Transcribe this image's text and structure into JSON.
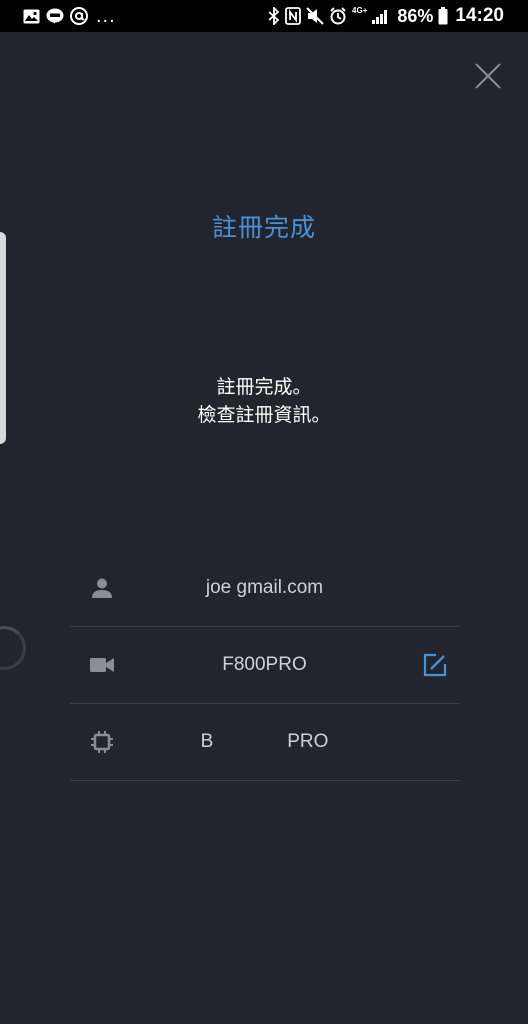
{
  "status_bar": {
    "overflow": "...",
    "network": "4G+",
    "battery": "86%",
    "time": "14:20",
    "icons_left": [
      "gallery-icon",
      "line-app-icon",
      "mail-at-icon"
    ],
    "icons_right": [
      "bluetooth-icon",
      "nfc-icon",
      "mute-icon",
      "alarm-icon",
      "signal-icon",
      "battery-icon"
    ]
  },
  "header": {
    "title": "註冊完成"
  },
  "message": {
    "line1": "註冊完成。",
    "line2": "檢查註冊資訊。"
  },
  "info": {
    "email": "joe        gmail.com",
    "camera_model": "F800PRO",
    "device_id": "B              PRO"
  },
  "colors": {
    "background": "#22252d",
    "accent": "#4a90d6",
    "divider": "#3c3f47",
    "icon_gray": "#8a8d94"
  }
}
